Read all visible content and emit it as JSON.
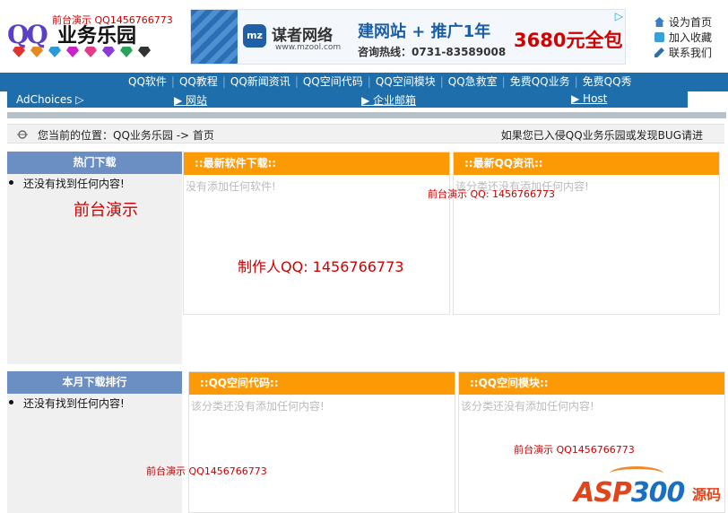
{
  "header": {
    "logo_mark": "QQ",
    "logo_name": "业务乐园",
    "demo_top": "前台演示 QQ1456766773",
    "gem_colors": [
      "#d33",
      "#e58a1e",
      "#2a9bd6",
      "#c2c",
      "#e23b8a",
      "#8a3ad6",
      "#2aa35a",
      "#333"
    ]
  },
  "banner": {
    "logo_text": "mz",
    "brand": "谋者网络",
    "site": "www.mzool.com",
    "slogan": "建网站 + 推广1年",
    "phone": "咨询热线：0731-83589008",
    "price": "3680元全包",
    "ad_icon": "▷"
  },
  "toplinks": [
    {
      "label": "设为首页",
      "icon": "home-icon",
      "color": "#3a7fc4"
    },
    {
      "label": "加入收藏",
      "icon": "bookmark-icon",
      "color": "#3a9fd4"
    },
    {
      "label": "联系我们",
      "icon": "edit-icon",
      "color": "#2f6fa8"
    }
  ],
  "nav": {
    "items": [
      "QQ软件",
      "QQ教程",
      "QQ新闻资讯",
      "QQ空间代码",
      "QQ空间模块",
      "QQ急救室",
      "免费QQ业务",
      "免费QQ秀"
    ]
  },
  "subnav": {
    "adchoices": "AdChoices ▷",
    "links": [
      "▶ 网站",
      "▶ 企业邮箱",
      "▶ Host"
    ]
  },
  "crumb": {
    "label": "您当前的位置：QQ业务乐园 -> 首页",
    "right": "如果您已入侵QQ业务乐园或发现BUG请进"
  },
  "left_hot": {
    "title": "热门下载",
    "item": "还没有找到任何内容!"
  },
  "left_rank": {
    "title": "本月下载排行",
    "item": "还没有找到任何内容!"
  },
  "panels": {
    "software": {
      "title": "::最新软件下载::",
      "empty": "没有添加任何软件!"
    },
    "news": {
      "title": "::最新QQ资讯::",
      "empty": "该分类还没有添加任何内容!"
    },
    "code": {
      "title": "::QQ空间代码::",
      "empty": "该分类还没有添加任何内容!"
    },
    "module": {
      "title": "::QQ空间模块::",
      "empty": "该分类还没有添加任何内容!"
    }
  },
  "overlays": {
    "demo1": "前台演示",
    "maker": "制作人QQ: 1456766773",
    "demo2": "前台演示 QQ: 1456766773",
    "demo3": "前台演示 QQ1456766773",
    "demo4": "前台演示  QQ1456766773"
  },
  "watermark": {
    "asp": "ASP",
    "num": "300",
    "suffix": "源码"
  }
}
